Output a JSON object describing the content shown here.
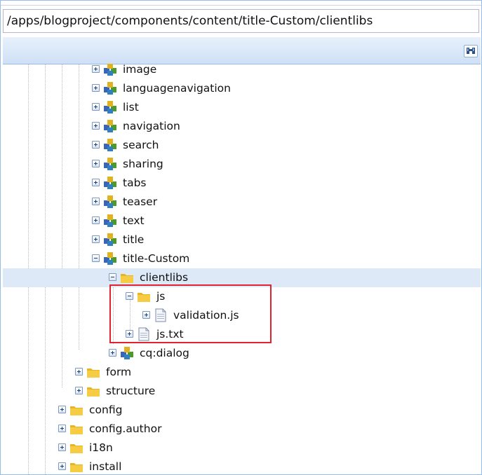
{
  "address_bar": {
    "path": "/apps/blogproject/components/content/title-Custom/clientlibs"
  },
  "toolbar": {
    "find_icon": "binoculars-icon"
  },
  "tree": {
    "nodes": [
      {
        "label": "image",
        "icon": "component-icon",
        "state": "collapsed"
      },
      {
        "label": "languagenavigation",
        "icon": "component-icon",
        "state": "collapsed"
      },
      {
        "label": "list",
        "icon": "component-icon",
        "state": "collapsed"
      },
      {
        "label": "navigation",
        "icon": "component-icon",
        "state": "collapsed"
      },
      {
        "label": "search",
        "icon": "component-icon",
        "state": "collapsed"
      },
      {
        "label": "sharing",
        "icon": "component-icon",
        "state": "collapsed"
      },
      {
        "label": "tabs",
        "icon": "component-icon",
        "state": "collapsed"
      },
      {
        "label": "teaser",
        "icon": "component-icon",
        "state": "collapsed"
      },
      {
        "label": "text",
        "icon": "component-icon",
        "state": "collapsed"
      },
      {
        "label": "title",
        "icon": "component-icon",
        "state": "collapsed"
      },
      {
        "label": "title-Custom",
        "icon": "component-icon",
        "state": "expanded"
      },
      {
        "label": "clientlibs",
        "icon": "folder-icon",
        "state": "expanded",
        "selected": true
      },
      {
        "label": "js",
        "icon": "folder-icon",
        "state": "expanded"
      },
      {
        "label": "validation.js",
        "icon": "file-icon",
        "state": "collapsed"
      },
      {
        "label": "js.txt",
        "icon": "file-icon",
        "state": "collapsed"
      },
      {
        "label": "cq:dialog",
        "icon": "component-icon",
        "state": "collapsed"
      },
      {
        "label": "form",
        "icon": "folder-icon",
        "state": "collapsed"
      },
      {
        "label": "structure",
        "icon": "folder-icon",
        "state": "collapsed"
      },
      {
        "label": "config",
        "icon": "folder-icon",
        "state": "collapsed"
      },
      {
        "label": "config.author",
        "icon": "folder-icon",
        "state": "collapsed"
      },
      {
        "label": "i18n",
        "icon": "folder-icon",
        "state": "collapsed"
      },
      {
        "label": "install",
        "icon": "folder-icon",
        "state": "collapsed"
      }
    ]
  },
  "colors": {
    "selection": "#dde9f7",
    "highlight_box": "#e0232e",
    "toolbar": "#cfe0f5"
  }
}
